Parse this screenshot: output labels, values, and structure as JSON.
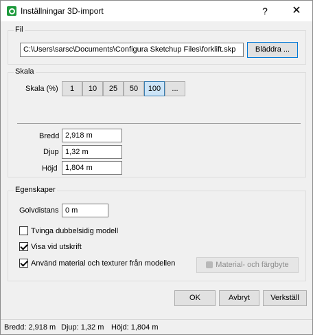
{
  "window": {
    "title": "Inställningar 3D-import",
    "help_label": "?",
    "close_label": "✕"
  },
  "file": {
    "legend": "Fil",
    "path": "C:\\Users\\sarsc\\Documents\\Configura Sketchup Files\\forklift.skp",
    "browse_label": "Bläddra ..."
  },
  "scale": {
    "legend": "Skala",
    "label": "Skala (%)",
    "options": [
      "1",
      "10",
      "25",
      "50",
      "100",
      "..."
    ],
    "selected": "100",
    "width_label": "Bredd",
    "width_value": "2,918 m",
    "depth_label": "Djup",
    "depth_value": "1,32 m",
    "height_label": "Höjd",
    "height_value": "1,804 m"
  },
  "properties": {
    "legend": "Egenskaper",
    "floor_label": "Golvdistans",
    "floor_value": "0 m",
    "force_double_label": "Tvinga dubbelsidig modell",
    "force_double_checked": false,
    "show_print_label": "Visa vid utskrift",
    "show_print_checked": true,
    "use_material_label": "Använd material och texturer från modellen",
    "use_material_checked": true,
    "material_button_label": "Material- och färgbyte"
  },
  "actions": {
    "ok_label": "OK",
    "cancel_label": "Avbryt",
    "apply_label": "Verkställ"
  },
  "status": {
    "width": "Bredd: 2,918 m",
    "depth": "Djup: 1,32 m",
    "height": "Höjd: 1,804 m"
  },
  "colors": {
    "accent": "#0078d7",
    "app_icon": "#1e9a3c",
    "selected_bg": "#cce4f7"
  }
}
